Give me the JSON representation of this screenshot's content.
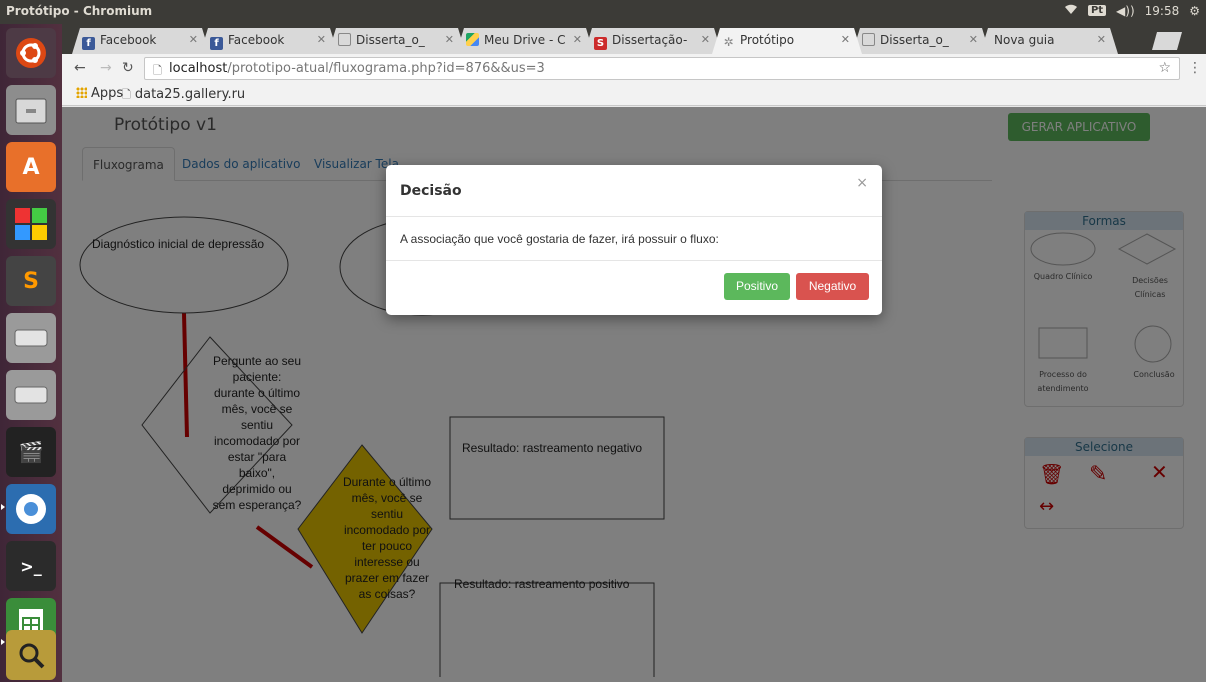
{
  "window": {
    "title": "Protótipo - Chromium",
    "keyboard": "Pt",
    "volume": "◀))",
    "time": "19:58",
    "wifi": "wifi-icon"
  },
  "tabs": [
    {
      "label": "Facebook",
      "icon": "facebook-icon",
      "color": "#3b5998"
    },
    {
      "label": "Facebook",
      "icon": "facebook-icon",
      "color": "#3b5998"
    },
    {
      "label": "Disserta_o_",
      "icon": "page-icon",
      "color": "#888888"
    },
    {
      "label": "Meu Drive - C",
      "icon": "drive-icon",
      "color": "#1fa463"
    },
    {
      "label": "Dissertação-",
      "icon": "s-icon",
      "color": "#cc2b2b"
    },
    {
      "label": "Protótipo",
      "icon": "settings-icon",
      "color": "#8a8a8a"
    },
    {
      "label": "Disserta_o_",
      "icon": "page-icon",
      "color": "#888888"
    },
    {
      "label": "Nova guia",
      "icon": "",
      "color": ""
    }
  ],
  "address": {
    "host": "localhost",
    "path": "/prototipo-atual/fluxograma.php?id=876&&us=3"
  },
  "bookmarks": {
    "apps": "Apps",
    "site": "data25.gallery.ru"
  },
  "page": {
    "title": "Protótipo v1",
    "gerar": "GERAR APLICATIVO",
    "nav": [
      "Fluxograma",
      "Dados do aplicativo",
      "Visualizar Tela"
    ],
    "shapes": {
      "diag": "Diagnóstico inicial de depressão",
      "q1": "Pergunte ao seu paciente: durante o último mês, você se sentiu incomodado por estar \"para baixo\", deprimido ou sem esperança?",
      "q2": "Durante o último mês, você se sentiu incomodado por ter pouco interesse ou prazer em fazer as coisas?",
      "res_neg": "Resultado: rastreamento negativo",
      "res_pos": "Resultado: rastreamento positivo"
    },
    "formas": {
      "head": "Formas",
      "quadro": "Quadro Clínico",
      "decisoes": "Decisões Clínicas",
      "processo": "Processo do atendimento",
      "conclusao": "Conclusão"
    },
    "selecione": {
      "head": "Selecione"
    }
  },
  "modal": {
    "title": "Decisão",
    "close": "×",
    "body": "A associação que você gostaria de fazer, irá possuir o fluxo:",
    "positive": "Positivo",
    "negative": "Negativo"
  },
  "colors": {
    "green": "#5cb85c",
    "red": "#d9534f",
    "diamond": "#e8c400",
    "connector": "#cc0000"
  }
}
